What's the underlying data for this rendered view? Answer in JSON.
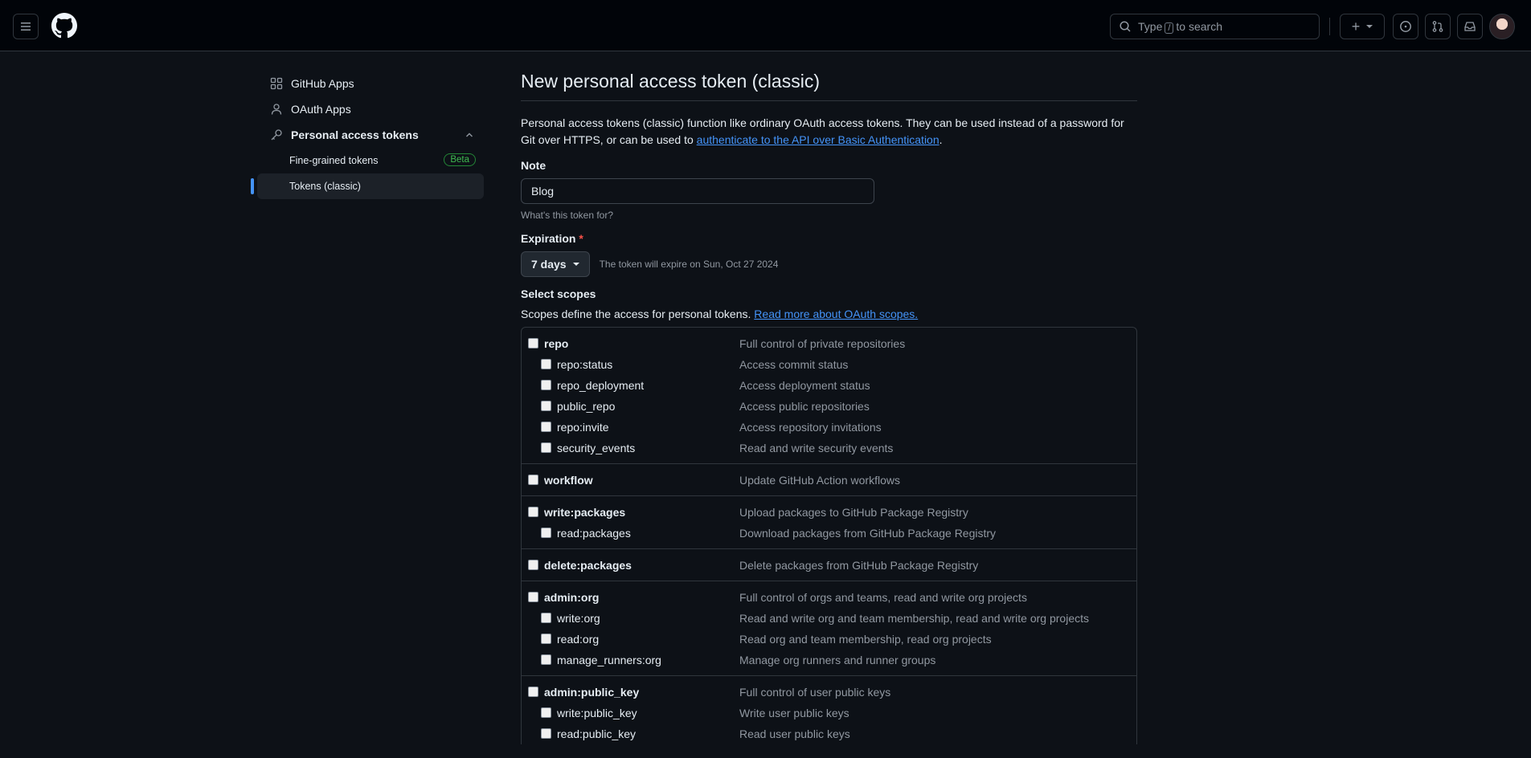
{
  "header": {
    "search_prefix": "Type",
    "search_key": "/",
    "search_suffix": "to search",
    "create_symbol": "+"
  },
  "sidebar": {
    "items": [
      {
        "label": "GitHub Apps",
        "icon": "apps-icon"
      },
      {
        "label": "OAuth Apps",
        "icon": "person-icon"
      },
      {
        "label": "Personal access tokens",
        "icon": "key-icon"
      }
    ],
    "subitems": [
      {
        "label": "Fine-grained tokens",
        "badge": "Beta"
      },
      {
        "label": "Tokens (classic)"
      }
    ]
  },
  "main": {
    "title": "New personal access token (classic)",
    "desc_text": "Personal access tokens (classic) function like ordinary OAuth access tokens. They can be used instead of a password for Git over HTTPS, or can be used to",
    "desc_link": "authenticate to the API over Basic Authentication",
    "desc_end": ".",
    "note_label": "Note",
    "note_value": "Blog",
    "note_hint": "What's this token for?",
    "expiration_label": "Expiration",
    "required_mark": "*",
    "expiration_value": "7 days",
    "expiration_note": "The token will expire on Sun, Oct 27 2024",
    "scopes_label": "Select scopes",
    "scopes_desc": "Scopes define the access for personal tokens.",
    "scopes_link": "Read more about OAuth scopes."
  },
  "scopes": [
    {
      "name": "repo",
      "desc": "Full control of private repositories",
      "children": [
        {
          "name": "repo:status",
          "desc": "Access commit status"
        },
        {
          "name": "repo_deployment",
          "desc": "Access deployment status"
        },
        {
          "name": "public_repo",
          "desc": "Access public repositories"
        },
        {
          "name": "repo:invite",
          "desc": "Access repository invitations"
        },
        {
          "name": "security_events",
          "desc": "Read and write security events"
        }
      ]
    },
    {
      "name": "workflow",
      "desc": "Update GitHub Action workflows",
      "children": []
    },
    {
      "name": "write:packages",
      "desc": "Upload packages to GitHub Package Registry",
      "children": [
        {
          "name": "read:packages",
          "desc": "Download packages from GitHub Package Registry"
        }
      ]
    },
    {
      "name": "delete:packages",
      "desc": "Delete packages from GitHub Package Registry",
      "children": []
    },
    {
      "name": "admin:org",
      "desc": "Full control of orgs and teams, read and write org projects",
      "children": [
        {
          "name": "write:org",
          "desc": "Read and write org and team membership, read and write org projects"
        },
        {
          "name": "read:org",
          "desc": "Read org and team membership, read org projects"
        },
        {
          "name": "manage_runners:org",
          "desc": "Manage org runners and runner groups"
        }
      ]
    },
    {
      "name": "admin:public_key",
      "desc": "Full control of user public keys",
      "children": [
        {
          "name": "write:public_key",
          "desc": "Write user public keys"
        },
        {
          "name": "read:public_key",
          "desc": "Read user public keys"
        }
      ]
    }
  ]
}
